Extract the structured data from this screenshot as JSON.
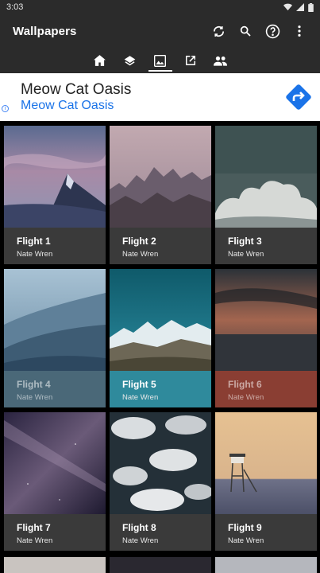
{
  "status": {
    "time": "3:03"
  },
  "app": {
    "title": "Wallpapers"
  },
  "tabs": [
    {
      "icon": "home-icon"
    },
    {
      "icon": "layers-icon"
    },
    {
      "icon": "image-icon",
      "active": true
    },
    {
      "icon": "open-external-icon"
    },
    {
      "icon": "people-icon"
    }
  ],
  "ad": {
    "title": "Meow Cat Oasis",
    "subtitle": "Meow Cat Oasis"
  },
  "wallpapers": [
    {
      "title": "Flight 1",
      "author": "Nate Wren"
    },
    {
      "title": "Flight 2",
      "author": "Nate Wren"
    },
    {
      "title": "Flight 3",
      "author": "Nate Wren"
    },
    {
      "title": "Flight 4",
      "author": "Nate Wren"
    },
    {
      "title": "Flight 5",
      "author": "Nate Wren"
    },
    {
      "title": "Flight 6",
      "author": "Nate Wren"
    },
    {
      "title": "Flight 7",
      "author": "Nate Wren"
    },
    {
      "title": "Flight 8",
      "author": "Nate Wren"
    },
    {
      "title": "Flight 9",
      "author": "Nate Wren"
    }
  ],
  "colors": {
    "appbar": "#2b2b2b",
    "card": "#3a3a3a",
    "teal": "#2f8a9c",
    "slate": "#4a6878",
    "rust": "#8a3e33",
    "ad_link": "#1a73e8",
    "ad_cta": "#1a73e8"
  }
}
